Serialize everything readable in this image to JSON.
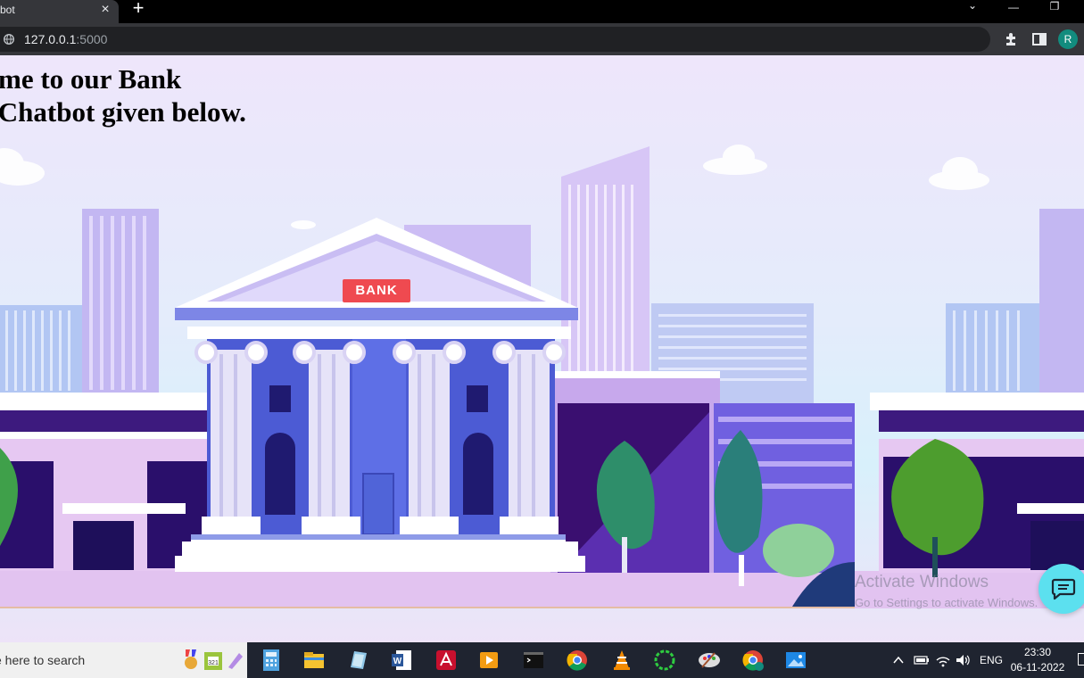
{
  "browser": {
    "tab_title": "bot",
    "tab_close": "×",
    "new_tab": "+",
    "url_host": "127.0.0.1",
    "url_port": ":5000",
    "profile_initial": "R",
    "window_controls": {
      "tab_search": "⌄",
      "minimize": "—",
      "restore": "❐"
    }
  },
  "page": {
    "welcome_line1": "me to our Bank",
    "welcome_line2": " Chatbot given below.",
    "building_sign": "BANK",
    "activation_title": "Activate Windows",
    "activation_subtitle": "Go to Settings to activate Windows."
  },
  "taskbar": {
    "search_placeholder": "e here to search",
    "apps": [
      "badge-icon",
      "calendar-icon",
      "pen-icon",
      "calculator-icon",
      "file-explorer-icon",
      "notes-icon",
      "word-icon",
      "acrobat-icon",
      "media-player-icon",
      "terminal-icon",
      "chrome-icon",
      "vlc-icon",
      "spinner-app-icon",
      "paint-icon",
      "chrome-profile-icon",
      "photos-icon"
    ],
    "tray_language": "ENG",
    "clock_time": "23:30",
    "clock_date": "06-11-2022"
  },
  "colors": {
    "chrome_dark": "#35363a",
    "omnibox": "#202124",
    "taskbar": "#1f2430",
    "chat_button": "#5ce0ef",
    "bank_sign": "#ef4a50"
  }
}
